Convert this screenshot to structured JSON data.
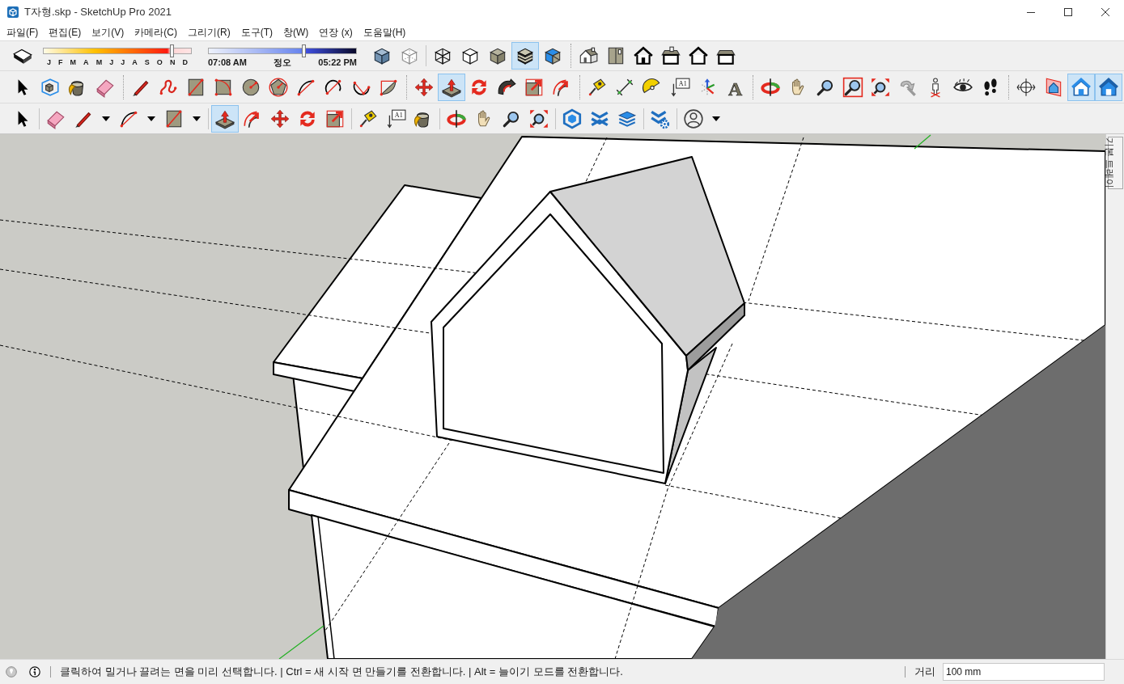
{
  "window": {
    "title": "T자형.skp - SketchUp Pro 2021"
  },
  "menu": [
    "파일(F)",
    "편집(E)",
    "보기(V)",
    "카메라(C)",
    "그리기(R)",
    "도구(T)",
    "창(W)",
    "연장 (x)",
    "도움말(H)"
  ],
  "shadow_sliders": {
    "month": {
      "level": 0.865,
      "labels": [
        "J",
        "F",
        "M",
        "A",
        "M",
        "J",
        "J",
        "A",
        "S",
        "O",
        "N",
        "D"
      ]
    },
    "time": {
      "level": 0.64,
      "labels": [
        "07:08 AM",
        "정오",
        "05:22 PM"
      ]
    }
  },
  "toolbars": [
    {
      "buttons": [
        {
          "selected": false
        },
        {
          "selected": false
        },
        {
          "selected": false
        },
        {
          "selected": false
        },
        {
          "selected": false
        },
        {
          "selected": false
        },
        {
          "selected": true
        },
        {
          "selected": false
        },
        {
          "selected": false
        },
        {
          "selected": false
        },
        {
          "selected": false
        },
        {
          "selected": false
        },
        {
          "selected": false
        },
        {
          "selected": false
        }
      ]
    },
    {
      "buttons": [
        {
          "selected": false
        },
        {
          "selected": false
        },
        {
          "selected": false
        },
        {
          "selected": false
        },
        {
          "selected": false
        },
        {
          "selected": false
        },
        {
          "selected": false
        },
        {
          "selected": false
        },
        {
          "selected": false
        },
        {
          "selected": false
        },
        {
          "selected": false
        },
        {
          "selected": false
        },
        {
          "selected": false
        },
        {
          "selected": false
        },
        {
          "selected": false
        },
        {
          "selected": true
        },
        {
          "selected": false
        },
        {
          "selected": false
        },
        {
          "selected": false
        },
        {
          "selected": false
        },
        {
          "selected": false
        },
        {
          "selected": false
        },
        {
          "selected": false
        },
        {
          "selected": false,
          "label": "A1"
        },
        {
          "selected": false
        },
        {
          "selected": false,
          "label": "A"
        },
        {
          "selected": false
        },
        {
          "selected": false
        },
        {
          "selected": false
        },
        {
          "selected": false
        },
        {
          "selected": false
        },
        {
          "selected": false
        },
        {
          "selected": false
        },
        {
          "selected": false
        },
        {
          "selected": false
        },
        {
          "selected": false
        },
        {
          "selected": false
        },
        {
          "selected": true
        },
        {
          "selected": true
        }
      ]
    },
    {
      "buttons": [
        {
          "selected": false
        },
        {
          "selected": false
        },
        {
          "selected": false
        },
        {
          "selected": false
        },
        {
          "selected": false
        },
        {
          "selected": true
        },
        {
          "selected": false
        },
        {
          "selected": false
        },
        {
          "selected": false
        },
        {
          "selected": false
        },
        {
          "selected": false
        },
        {
          "selected": false,
          "label": "A1"
        },
        {
          "selected": false
        },
        {
          "selected": false
        },
        {
          "selected": false
        },
        {
          "selected": false
        },
        {
          "selected": false
        },
        {
          "selected": false
        },
        {
          "selected": false
        },
        {
          "selected": false
        },
        {
          "selected": false
        },
        {
          "selected": false
        }
      ]
    }
  ],
  "tray": {
    "tab": "기본 트레이"
  },
  "status_bar": {
    "hint": "클릭하여 밀거나 끌려는 면을 미리 선택합니다. | Ctrl = 새 시작 면 만들기를 전환합니다. | Alt = 늘이기 모드를 전환합니다.",
    "measurement_label": "거리",
    "measurement_value": "100 mm"
  }
}
